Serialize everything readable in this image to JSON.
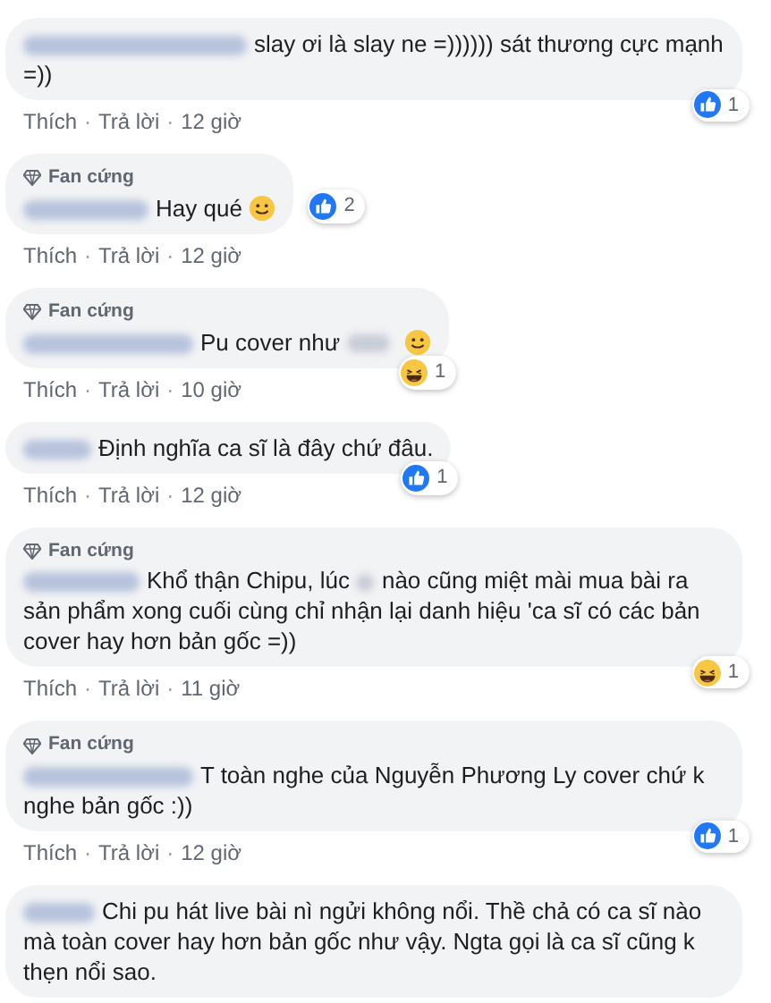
{
  "comments": [
    {
      "body_parts": [
        "slay ơi là slay ne =)))))) sát thương cực mạnh =))"
      ],
      "emoji": false,
      "reaction": {
        "kind": "like",
        "count": "1",
        "beside_text": false
      },
      "actions": {
        "like": "Thích",
        "separator": "·",
        "reply": "Trả lời",
        "separator_2": "·",
        "time": "12 giờ"
      }
    },
    {
      "fan_badge": "Fan cứng",
      "body_parts": [
        "Hay qué"
      ],
      "emoji": true,
      "reaction": {
        "kind": "like",
        "count": "2",
        "beside_text": true
      },
      "actions": {
        "like": "Thích",
        "separator": "·",
        "reply": "Trả lời",
        "separator_2": "·",
        "time": "12 giờ"
      }
    },
    {
      "fan_badge": "Fan cứng",
      "body_parts": [
        "Pu cover như"
      ],
      "blur_end": true,
      "emoji": true,
      "reaction": {
        "kind": "haha",
        "count": "1",
        "beside_text": false
      },
      "actions": {
        "like": "Thích",
        "separator": "·",
        "reply": "Trả lời",
        "separator_2": "·",
        "time": "10 giờ"
      }
    },
    {
      "body_parts": [
        "Định nghĩa ca sĩ là đây chứ đâu."
      ],
      "emoji": false,
      "reaction": {
        "kind": "like",
        "count": "1",
        "beside_text": false
      },
      "actions": {
        "like": "Thích",
        "separator": "·",
        "reply": "Trả lời",
        "separator_2": "·",
        "time": "12 giờ"
      }
    },
    {
      "fan_badge": "Fan cứng",
      "body_parts": [
        "Khổ thận Chipu, lúc",
        "nào cũng miệt mài mua bài ra sản phẩm xong cuối cùng chỉ nhận lại danh hiệu 'ca sĩ có các bản cover hay hơn bản gốc =))"
      ],
      "emoji": false,
      "reaction": {
        "kind": "haha",
        "count": "1",
        "beside_text": false
      },
      "actions": {
        "like": "Thích",
        "separator": "·",
        "reply": "Trả lời",
        "separator_2": "·",
        "time": "11 giờ"
      }
    },
    {
      "fan_badge": "Fan cứng",
      "body_parts": [
        "T toàn nghe của Nguyễn Phương Ly cover chứ k nghe bản gốc :))"
      ],
      "emoji": false,
      "reaction": {
        "kind": "like",
        "count": "1",
        "beside_text": false
      },
      "actions": {
        "like": "Thích",
        "separator": "·",
        "reply": "Trả lời",
        "separator_2": "·",
        "time": "12 giờ"
      }
    },
    {
      "body_parts": [
        "Chi pu hát live bài nì ngửi không nổi. Thề chả có ca sĩ nào mà toàn cover hay hơn bản gốc như vậy. Ngta gọi là ca sĩ cũng k thẹn nổi sao."
      ],
      "emoji": false
    }
  ]
}
